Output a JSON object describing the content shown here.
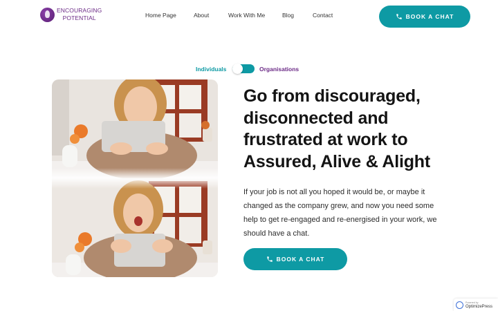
{
  "logo": {
    "line1": "ENCOURAGING",
    "line2": "POTENTIAL"
  },
  "nav": {
    "items": [
      "Home Page",
      "About",
      "Work With Me",
      "Blog",
      "Contact"
    ]
  },
  "header_cta": {
    "label": "BOOK A CHAT"
  },
  "toggle": {
    "left_label": "Individuals",
    "right_label": "Organisations"
  },
  "hero": {
    "headline": "Go from discouraged, disconnected and frustrated at work to Assured, Alive & Alight",
    "body": "If your job is not all you hoped it would be, or maybe it changed as the company grew, and now you need some help to get re-engaged and re-energised in your work, we should have a chat.",
    "cta_label": "BOOK A CHAT"
  },
  "badge": {
    "small": "Powered by",
    "label": "OptimizePress"
  },
  "colors": {
    "teal": "#0e9aa4",
    "purple": "#6b2a86"
  }
}
